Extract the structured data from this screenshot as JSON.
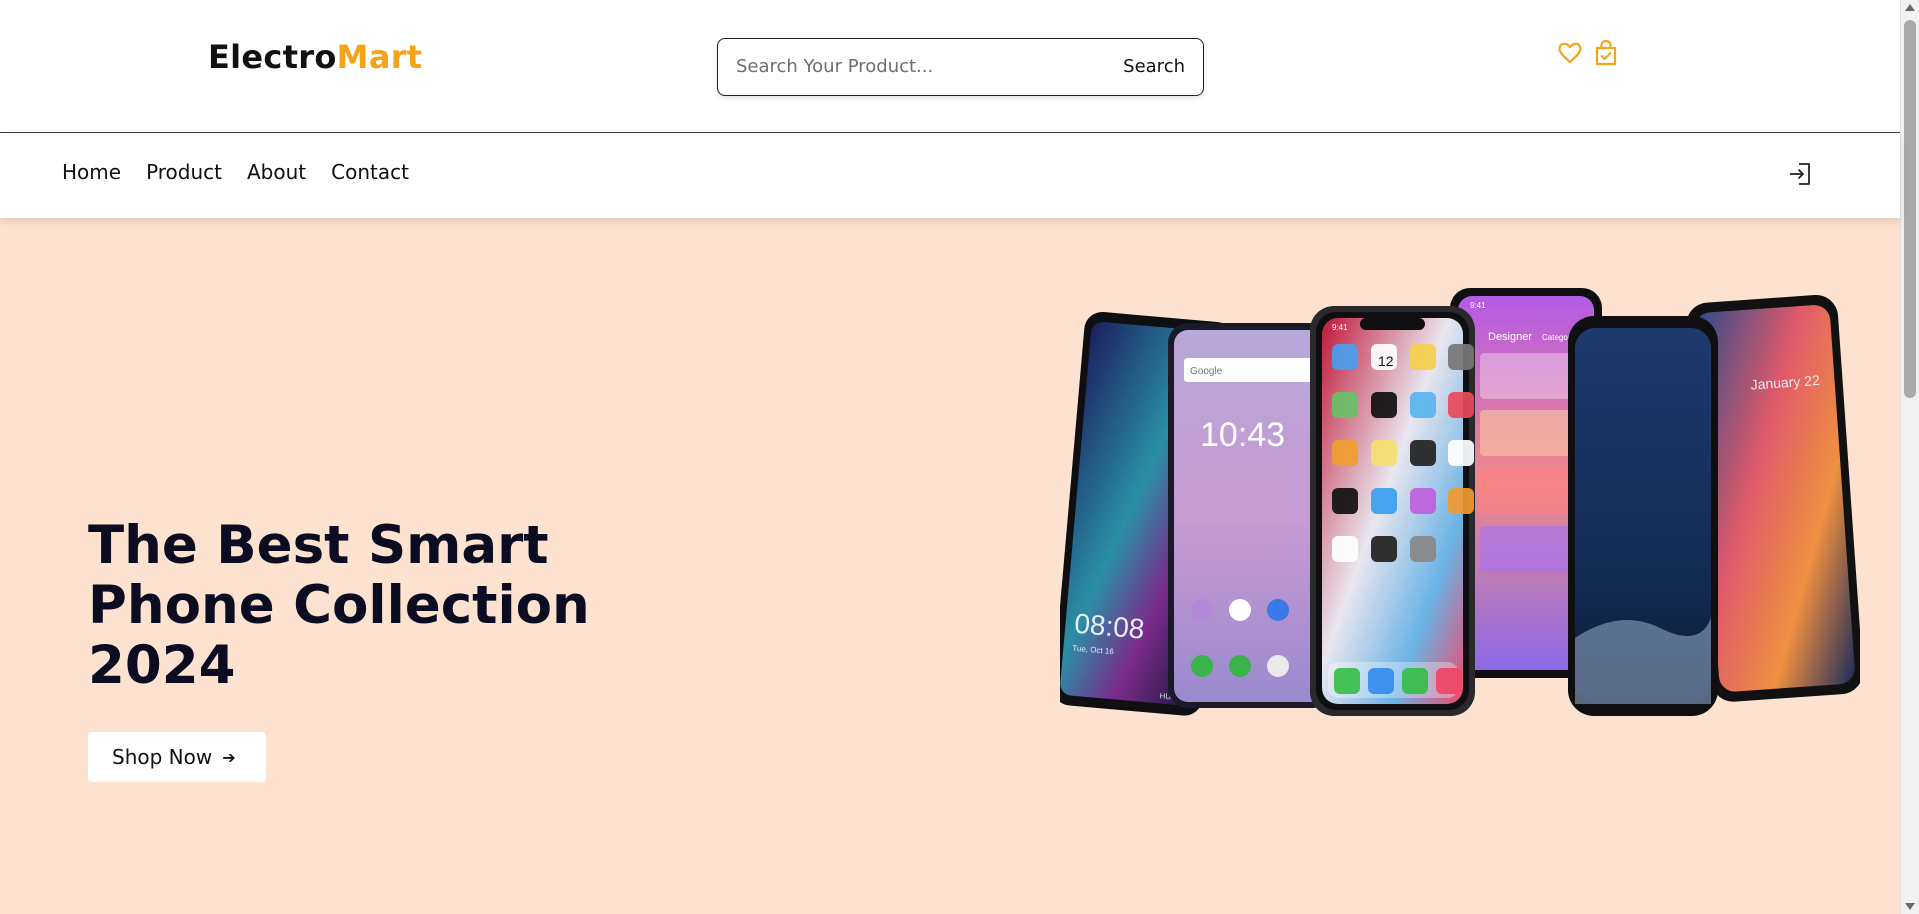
{
  "header": {
    "logo_part1": "Electro",
    "logo_part2": "Mart",
    "search_placeholder": "Search Your Product...",
    "search_button": "Search",
    "icons": [
      "heart-icon",
      "shopping-bag-icon"
    ]
  },
  "nav": {
    "items": [
      {
        "label": "Home"
      },
      {
        "label": "Product"
      },
      {
        "label": "About"
      },
      {
        "label": "Contact"
      }
    ],
    "login_icon": "login-icon"
  },
  "hero": {
    "headline": "The Best Smart Phone Collection 2024",
    "cta_label": "Shop Now",
    "cta_icon": "arrow-right-icon",
    "phones": [
      {
        "time": "08:08",
        "date": "Tue, Oct 16",
        "brand": "HUAWEI"
      },
      {
        "search": "Google",
        "time": "10:43"
      },
      {
        "status_time": "9:41",
        "calendar_day": "12"
      },
      {
        "status_time": "9:41",
        "header": "Designer",
        "tab": "Category"
      },
      {},
      {
        "date": "January 22"
      }
    ]
  },
  "colors": {
    "brand_accent": "#f5a31a",
    "hero_background": "#fde3cf",
    "headline_text": "#0b0b22"
  }
}
